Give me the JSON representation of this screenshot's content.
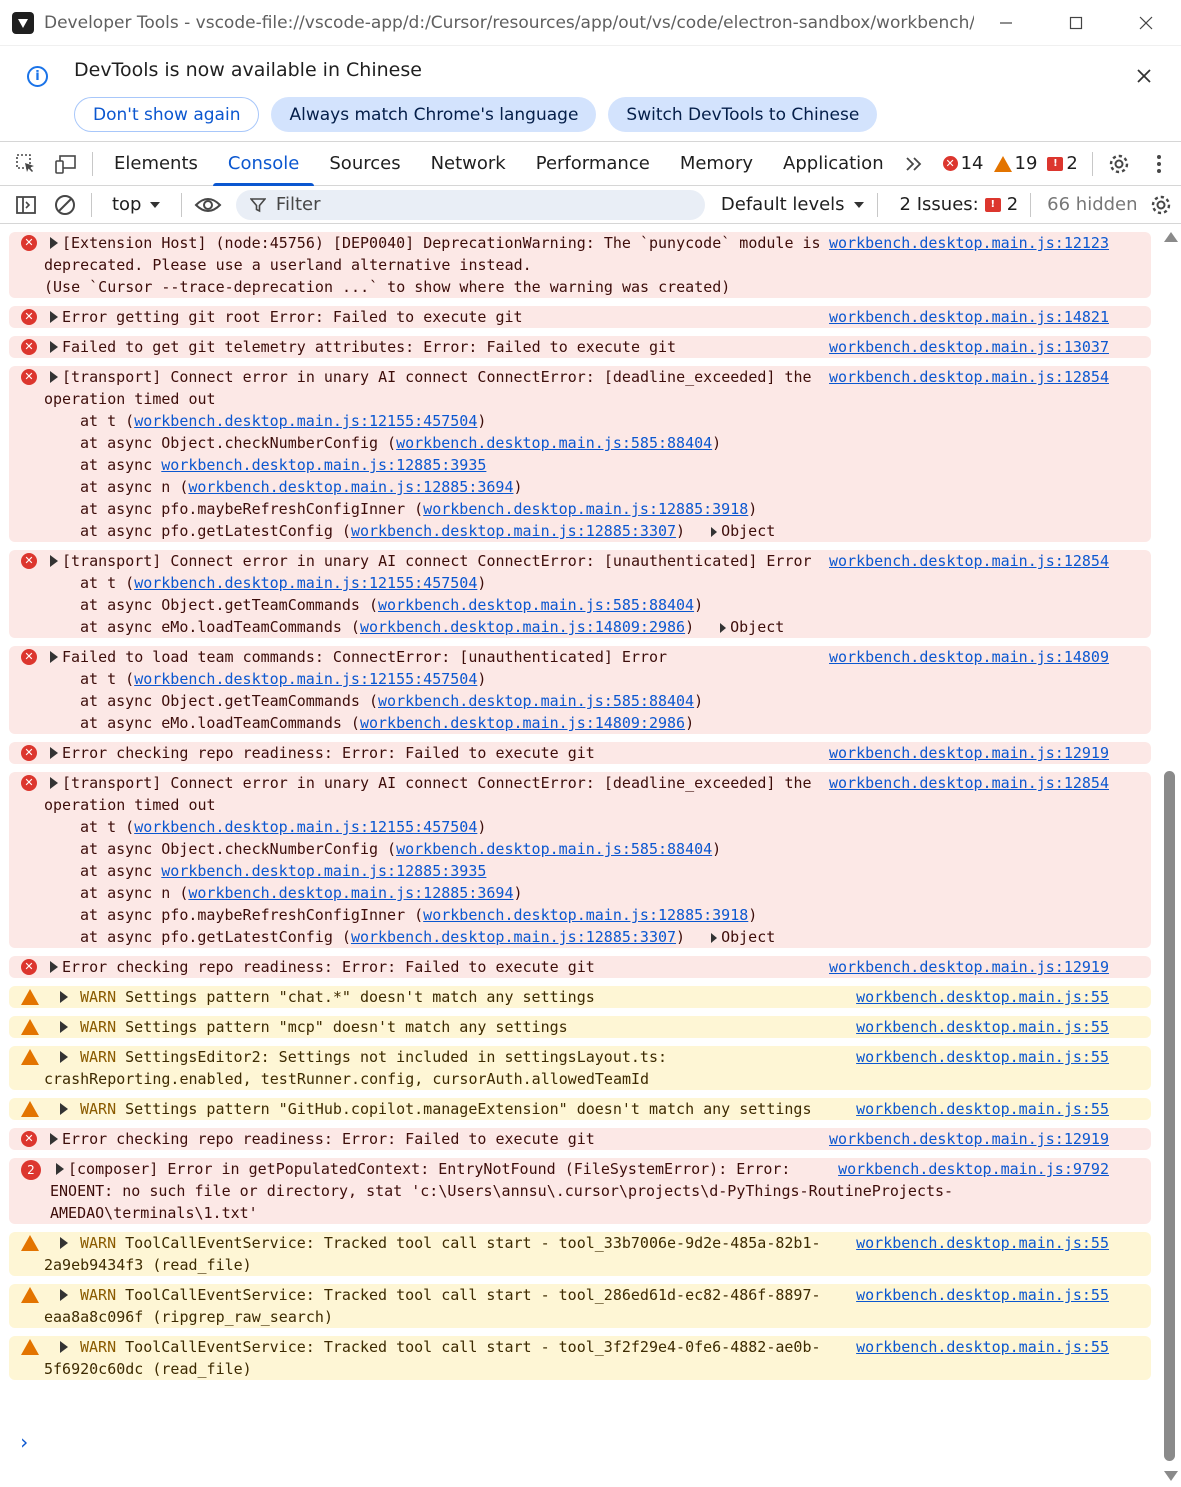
{
  "window": {
    "title": "Developer Tools - vscode-file://vscode-app/d:/Cursor/resources/app/out/vs/code/electron-sandbox/workbench/w...",
    "minimize_icon": "minimize-icon",
    "maximize_icon": "maximize-icon",
    "close_icon": "close-icon"
  },
  "infobar": {
    "message": "DevTools is now available in Chinese",
    "buttons": [
      "Don't show again",
      "Always match Chrome's language",
      "Switch DevTools to Chinese"
    ]
  },
  "tabs": [
    "Elements",
    "Console",
    "Sources",
    "Network",
    "Performance",
    "Memory",
    "Application"
  ],
  "active_tab": "Console",
  "counts": {
    "errors": "14",
    "warnings": "19",
    "issues": "2"
  },
  "toolbar": {
    "context": "top",
    "filter_placeholder": "Filter",
    "levels": "Default levels",
    "issues_label": "2 Issues:",
    "issues_count": "2",
    "hidden": "66 hidden"
  },
  "colors": {
    "accent": "#0b57d0",
    "error_bg": "#fce8e6",
    "warn_bg": "#fef6d5",
    "error": "#dc362e",
    "warn": "#e37400"
  },
  "messages": [
    {
      "type": "err",
      "src": "workbench.desktop.main.js:12123",
      "lines": [
        "[Extension Host] (node:45756) [DEP0040] DeprecationWarning: The `punycode` module is",
        "deprecated. Please use a userland alternative instead.",
        "(Use `Cursor --trace-deprecation ...` to show where the warning was created)"
      ]
    },
    {
      "type": "err",
      "src": "workbench.desktop.main.js:14821",
      "lines": [
        "Error getting git root Error: Failed to execute git"
      ]
    },
    {
      "type": "err",
      "src": "workbench.desktop.main.js:13037",
      "lines": [
        "Failed to get git telemetry attributes: Error: Failed to execute git"
      ]
    },
    {
      "type": "err",
      "src": "workbench.desktop.main.js:12854",
      "lines": [
        "[transport] Connect error in unary AI connect ConnectError: [deadline_exceeded] the",
        "operation timed out"
      ],
      "stack": [
        [
          "at t (",
          "workbench.desktop.main.js:12155:457504",
          ")"
        ],
        [
          "at async Object.checkNumberConfig (",
          "workbench.desktop.main.js:585:88404",
          ")"
        ],
        [
          "at async ",
          "workbench.desktop.main.js:12885:3935",
          ""
        ],
        [
          "at async n (",
          "workbench.desktop.main.js:12885:3694",
          ")"
        ],
        [
          "at async pfo.maybeRefreshConfigInner (",
          "workbench.desktop.main.js:12885:3918",
          ")"
        ],
        [
          "at async pfo.getLatestConfig (",
          "workbench.desktop.main.js:12885:3307",
          ")"
        ]
      ],
      "object": "Object"
    },
    {
      "type": "err",
      "src": "workbench.desktop.main.js:12854",
      "lines": [
        "[transport] Connect error in unary AI connect ConnectError: [unauthenticated] Error"
      ],
      "stack": [
        [
          "at t (",
          "workbench.desktop.main.js:12155:457504",
          ")"
        ],
        [
          "at async Object.getTeamCommands (",
          "workbench.desktop.main.js:585:88404",
          ")"
        ],
        [
          "at async eMo.loadTeamCommands (",
          "workbench.desktop.main.js:14809:2986",
          ")"
        ]
      ],
      "object": "Object"
    },
    {
      "type": "err",
      "src": "workbench.desktop.main.js:14809",
      "lines": [
        "Failed to load team commands: ConnectError: [unauthenticated] Error"
      ],
      "stack": [
        [
          "at t (",
          "workbench.desktop.main.js:12155:457504",
          ")"
        ],
        [
          "at async Object.getTeamCommands (",
          "workbench.desktop.main.js:585:88404",
          ")"
        ],
        [
          "at async eMo.loadTeamCommands (",
          "workbench.desktop.main.js:14809:2986",
          ")"
        ]
      ]
    },
    {
      "type": "err",
      "src": "workbench.desktop.main.js:12919",
      "lines": [
        "Error checking repo readiness: Error: Failed to execute git"
      ]
    },
    {
      "type": "err",
      "src": "workbench.desktop.main.js:12854",
      "lines": [
        "[transport] Connect error in unary AI connect ConnectError: [deadline_exceeded] the",
        "operation timed out"
      ],
      "stack": [
        [
          "at t (",
          "workbench.desktop.main.js:12155:457504",
          ")"
        ],
        [
          "at async Object.checkNumberConfig (",
          "workbench.desktop.main.js:585:88404",
          ")"
        ],
        [
          "at async ",
          "workbench.desktop.main.js:12885:3935",
          ""
        ],
        [
          "at async n (",
          "workbench.desktop.main.js:12885:3694",
          ")"
        ],
        [
          "at async pfo.maybeRefreshConfigInner (",
          "workbench.desktop.main.js:12885:3918",
          ")"
        ],
        [
          "at async pfo.getLatestConfig (",
          "workbench.desktop.main.js:12885:3307",
          ")"
        ]
      ],
      "object": "Object"
    },
    {
      "type": "err",
      "src": "workbench.desktop.main.js:12919",
      "lines": [
        "Error checking repo readiness: Error: Failed to execute git"
      ]
    },
    {
      "type": "warn",
      "src": "workbench.desktop.main.js:55",
      "warn": true,
      "lines": [
        "Settings pattern \"chat.*\" doesn't match any settings"
      ]
    },
    {
      "type": "warn",
      "src": "workbench.desktop.main.js:55",
      "warn": true,
      "lines": [
        "Settings pattern \"mcp\" doesn't match any settings"
      ]
    },
    {
      "type": "warn",
      "src": "workbench.desktop.main.js:55",
      "warn": true,
      "lines": [
        "SettingsEditor2: Settings not included in settingsLayout.ts:",
        "crashReporting.enabled, testRunner.config, cursorAuth.allowedTeamId"
      ]
    },
    {
      "type": "warn",
      "src": "workbench.desktop.main.js:55",
      "warn": true,
      "lines": [
        "Settings pattern \"GitHub.copilot.manageExtension\" doesn't match any settings"
      ]
    },
    {
      "type": "err",
      "src": "workbench.desktop.main.js:12919",
      "lines": [
        "Error checking repo readiness: Error: Failed to execute git"
      ]
    },
    {
      "type": "err",
      "src": "workbench.desktop.main.js:9792",
      "badge": "2",
      "lines": [
        "[composer] Error in getPopulatedContext: EntryNotFound (FileSystemError): Error:",
        "ENOENT: no such file or directory, stat 'c:\\Users\\annsu\\.cursor\\projects\\d-PyThings-RoutineProjects-",
        "AMEDAO\\terminals\\1.txt'"
      ]
    },
    {
      "type": "warn",
      "src": "workbench.desktop.main.js:55",
      "warn": true,
      "lines": [
        "ToolCallEventService: Tracked tool call start - tool_33b7006e-9d2e-485a-82b1-",
        "2a9eb9434f3 (read_file)"
      ]
    },
    {
      "type": "warn",
      "src": "workbench.desktop.main.js:55",
      "warn": true,
      "lines": [
        "ToolCallEventService: Tracked tool call start - tool_286ed61d-ec82-486f-8897-",
        "eaa8a8c096f (ripgrep_raw_search)"
      ]
    },
    {
      "type": "warn",
      "src": "workbench.desktop.main.js:55",
      "warn": true,
      "lines": [
        "ToolCallEventService: Tracked tool call start - tool_3f2f29e4-0fe6-4882-ae0b-",
        "5f6920c60dc (read_file)"
      ]
    }
  ],
  "warn_label": "WARN",
  "prompt": "›"
}
